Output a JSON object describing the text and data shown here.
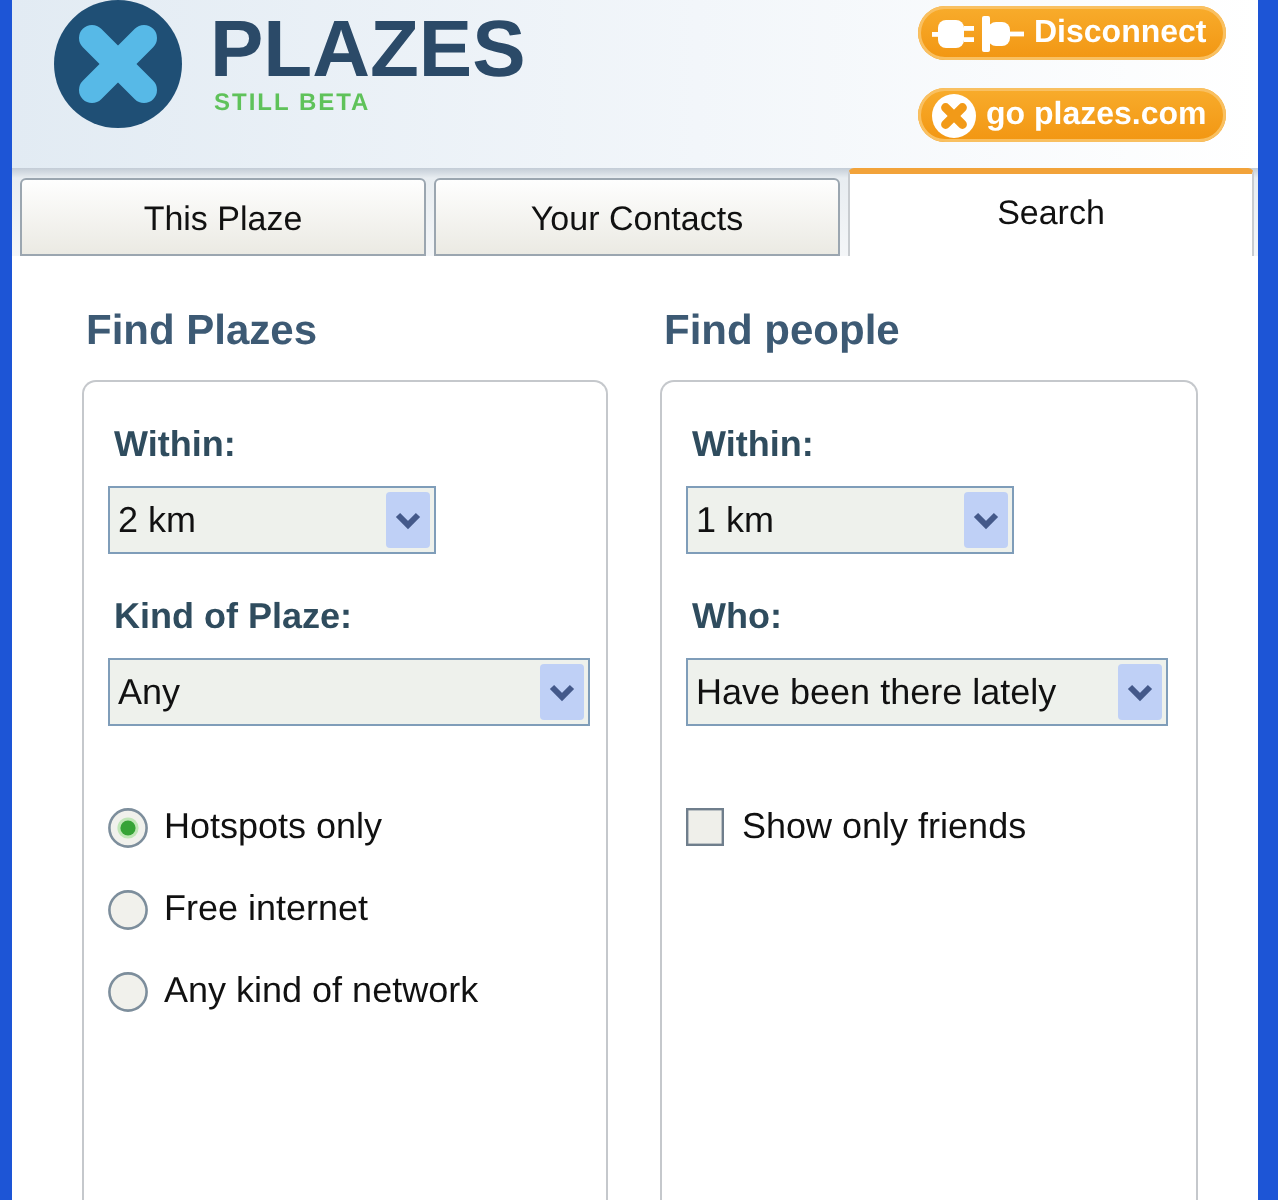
{
  "header": {
    "brand": "PLAZES",
    "tagline": "STILL BETA",
    "buttons": [
      {
        "kind": "disconnect",
        "label": "Disconnect"
      },
      {
        "kind": "link",
        "label": "go plazes.com"
      }
    ]
  },
  "tabs": [
    {
      "label": "This Plaze",
      "selected": false
    },
    {
      "label": "Your Contacts",
      "selected": false
    },
    {
      "label": "Search",
      "selected": true
    }
  ],
  "panels": [
    {
      "title": "Find Plazes",
      "fields": [
        {
          "label": "Within:",
          "value": "2 km"
        },
        {
          "label": "Kind of Plaze:",
          "value": "Any"
        }
      ],
      "options": [
        {
          "kind": "radio",
          "label": "Hotspots only",
          "selected": true
        },
        {
          "kind": "radio",
          "label": "Free internet",
          "selected": false
        },
        {
          "kind": "radio",
          "label": "Any kind of network",
          "selected": false
        }
      ]
    },
    {
      "title": "Find people",
      "fields": [
        {
          "label": "Within:",
          "value": "1 km"
        },
        {
          "label": "Who:",
          "value": "Have been there lately"
        }
      ],
      "options": [
        {
          "kind": "checkbox",
          "label": "Show only friends",
          "checked": false
        }
      ]
    }
  ]
}
